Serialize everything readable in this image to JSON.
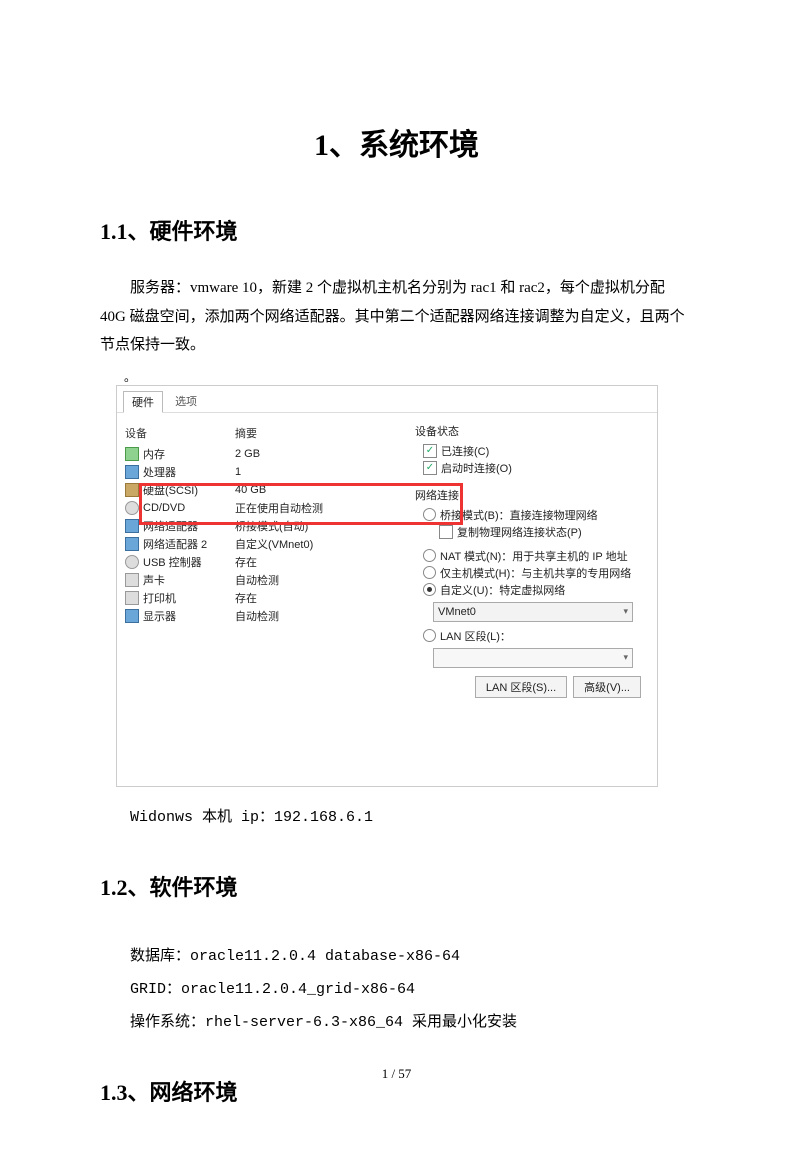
{
  "title": "1、系统环境",
  "s11": {
    "heading": "1.1、硬件环境",
    "para": "服务器：vmware 10，新建 2 个虚拟机主机名分别为 rac1 和 rac2，每个虚拟机分配 40G 磁盘空间，添加两个网络适配器。其中第二个适配器网络连接调整为自定义，且两个节点保持一致。",
    "dot": "。",
    "ip_line": "Widonws 本机 ip：192.168.6.1"
  },
  "vm": {
    "tabs": {
      "hw": "硬件",
      "opt": "选项"
    },
    "headers": {
      "device": "设备",
      "summary": "摘要"
    },
    "rows": [
      {
        "icon": "mem",
        "name": "内存",
        "summary": "2 GB"
      },
      {
        "icon": "cpu",
        "name": "处理器",
        "summary": "1"
      },
      {
        "icon": "disk",
        "name": "硬盘(SCSI)",
        "summary": "40 GB"
      },
      {
        "icon": "cd",
        "name": "CD/DVD",
        "summary": "正在使用自动检测"
      },
      {
        "icon": "net",
        "name": "网络适配器",
        "summary": "桥接模式(自动)"
      },
      {
        "icon": "net",
        "name": "网络适配器 2",
        "summary": "自定义(VMnet0)"
      },
      {
        "icon": "cd",
        "name": "USB 控制器",
        "summary": "存在"
      },
      {
        "icon": "snd",
        "name": "声卡",
        "summary": "自动检测"
      },
      {
        "icon": "prn",
        "name": "打印机",
        "summary": "存在"
      },
      {
        "icon": "dsp",
        "name": "显示器",
        "summary": "自动检测"
      }
    ],
    "right": {
      "state_label": "设备状态",
      "connected": "已连接(C)",
      "connect_power": "启动时连接(O)",
      "netconn_label": "网络连接",
      "bridge": "桥接模式(B)：直接连接物理网络",
      "replicate": "复制物理网络连接状态(P)",
      "nat": "NAT 模式(N)：用于共享主机的 IP 地址",
      "hostonly": "仅主机模式(H)：与主机共享的专用网络",
      "custom": "自定义(U)：特定虚拟网络",
      "custom_value": "VMnet0",
      "lan": "LAN 区段(L)：",
      "btn_lan": "LAN 区段(S)...",
      "btn_adv": "高级(V)..."
    }
  },
  "s12": {
    "heading": "1.2、软件环境",
    "db": "数据库：oracle11.2.0.4 database-x86-64",
    "grid": "GRID：oracle11.2.0.4_grid-x86-64",
    "os": "操作系统：rhel-server-6.3-x86_64 采用最小化安装"
  },
  "s13": {
    "heading": "1.3、网络环境"
  },
  "footer": "1 / 57"
}
